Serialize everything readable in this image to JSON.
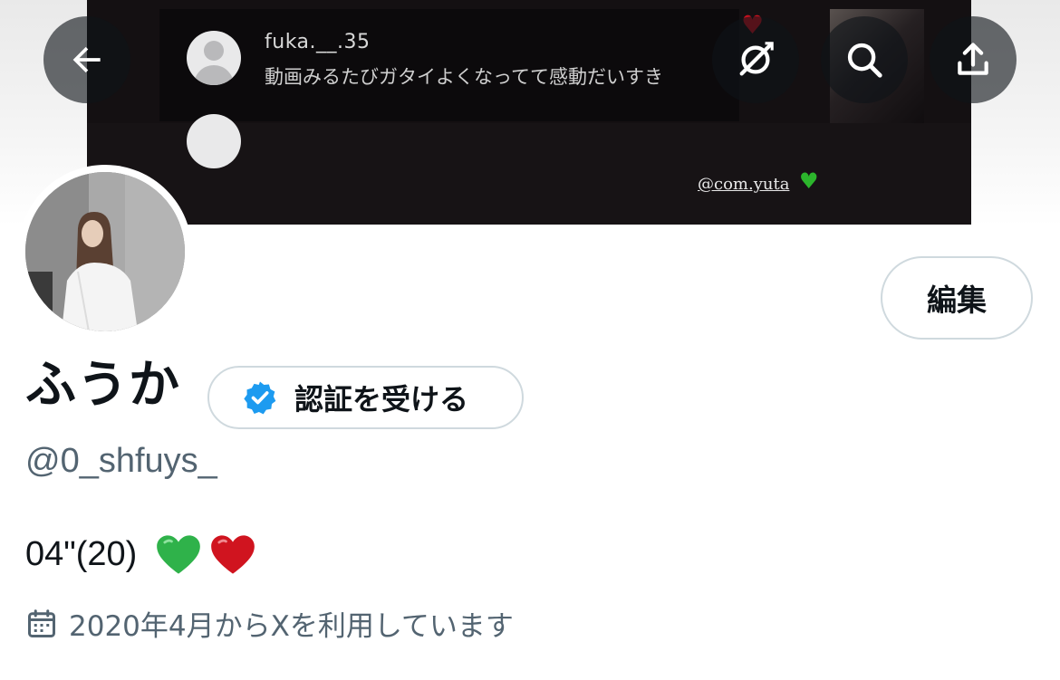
{
  "banner": {
    "comment_user": "fuka.__.35",
    "comment_text": "動画みるたびガタイよくなってて感動だいすき",
    "tag": "@com.yuta",
    "tag_emoji": "green-heart"
  },
  "nav": {
    "back_icon": "arrow-left-icon",
    "grok_icon": "grok-icon",
    "search_icon": "search-icon",
    "share_icon": "share-icon"
  },
  "profile": {
    "display_name": "ふうか",
    "verify_label": "認証を受ける",
    "handle": "@0_shfuys_",
    "bio": "04\"(20)",
    "bio_emojis": [
      "green-heart",
      "red-heart"
    ],
    "joined": "2020年4月からXを利用しています",
    "edit_label": "編集"
  },
  "colors": {
    "verified_blue": "#1d9bf0",
    "secondary_text": "#536471",
    "border": "#cfd9de",
    "green_heart": "#2fb24a",
    "red_heart": "#d0141f"
  }
}
